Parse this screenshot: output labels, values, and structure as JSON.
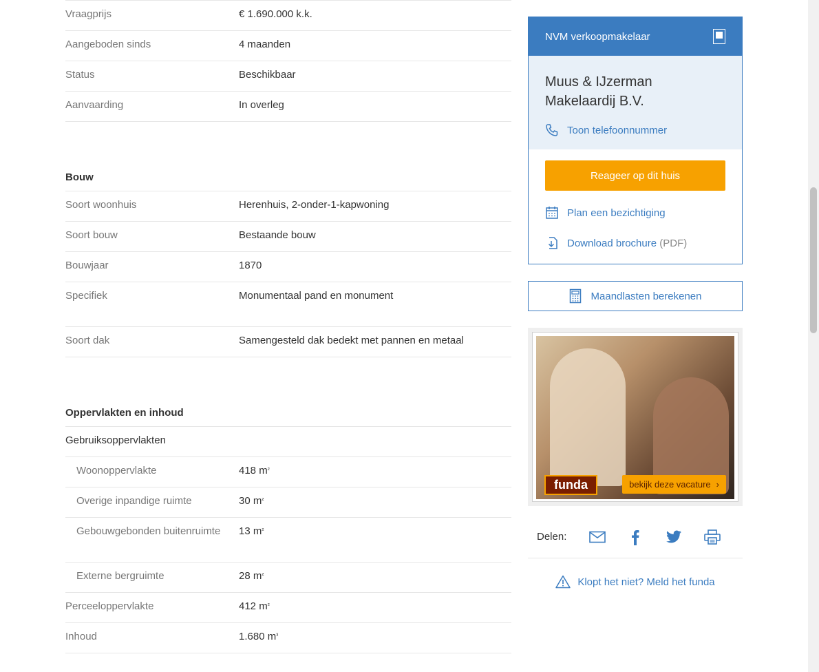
{
  "details": {
    "top_rows": [
      {
        "label": "Vraagprijs",
        "value": "€ 1.690.000 k.k."
      },
      {
        "label": "Aangeboden sinds",
        "value": "4 maanden"
      },
      {
        "label": "Status",
        "value": "Beschikbaar"
      },
      {
        "label": "Aanvaarding",
        "value": "In overleg"
      }
    ],
    "bouw": {
      "title": "Bouw",
      "rows": [
        {
          "label": "Soort woonhuis",
          "value": "Herenhuis, 2-onder-1-kapwoning"
        },
        {
          "label": "Soort bouw",
          "value": "Bestaande bouw"
        },
        {
          "label": "Bouwjaar",
          "value": "1870"
        },
        {
          "label": "Specifiek",
          "value": "Monumentaal pand en monument"
        },
        {
          "label": "Soort dak",
          "value": "Samengesteld dak bedekt met pannen en metaal"
        }
      ]
    },
    "oppervlakten": {
      "title": "Oppervlakten en inhoud",
      "sub_title": "Gebruiksoppervlakten",
      "indented_rows": [
        {
          "label": "Woonoppervlakte",
          "value": "418 m",
          "unit_sup": "²"
        },
        {
          "label": "Overige inpandige ruimte",
          "value": "30 m",
          "unit_sup": "²"
        },
        {
          "label": "Gebouwgebonden buitenruimte",
          "value": "13 m",
          "unit_sup": "²"
        },
        {
          "label": "Externe bergruimte",
          "value": "28 m",
          "unit_sup": "²"
        }
      ],
      "rows": [
        {
          "label": "Perceeloppervlakte",
          "value": "412 m",
          "unit_sup": "²"
        },
        {
          "label": "Inhoud",
          "value": "1.680 m",
          "unit_sup": "³"
        }
      ]
    }
  },
  "sidebar": {
    "agent_header": "NVM verkoopmakelaar",
    "agent_name": "Muus & IJzerman Makelaardij B.V.",
    "phone_link": "Toon telefoonnummer",
    "respond_button": "Reageer op dit huis",
    "viewing_link": "Plan een bezichtiging",
    "brochure_link": "Download brochure",
    "brochure_suffix": "(PDF)",
    "calc_button": "Maandlasten berekenen",
    "ad": {
      "logo": "funda",
      "cta": "bekijk deze vacature"
    },
    "share_label": "Delen:",
    "report_link": "Klopt het niet? Meld het funda"
  },
  "colors": {
    "accent": "#3b7cc0",
    "cta": "#f7a100"
  }
}
